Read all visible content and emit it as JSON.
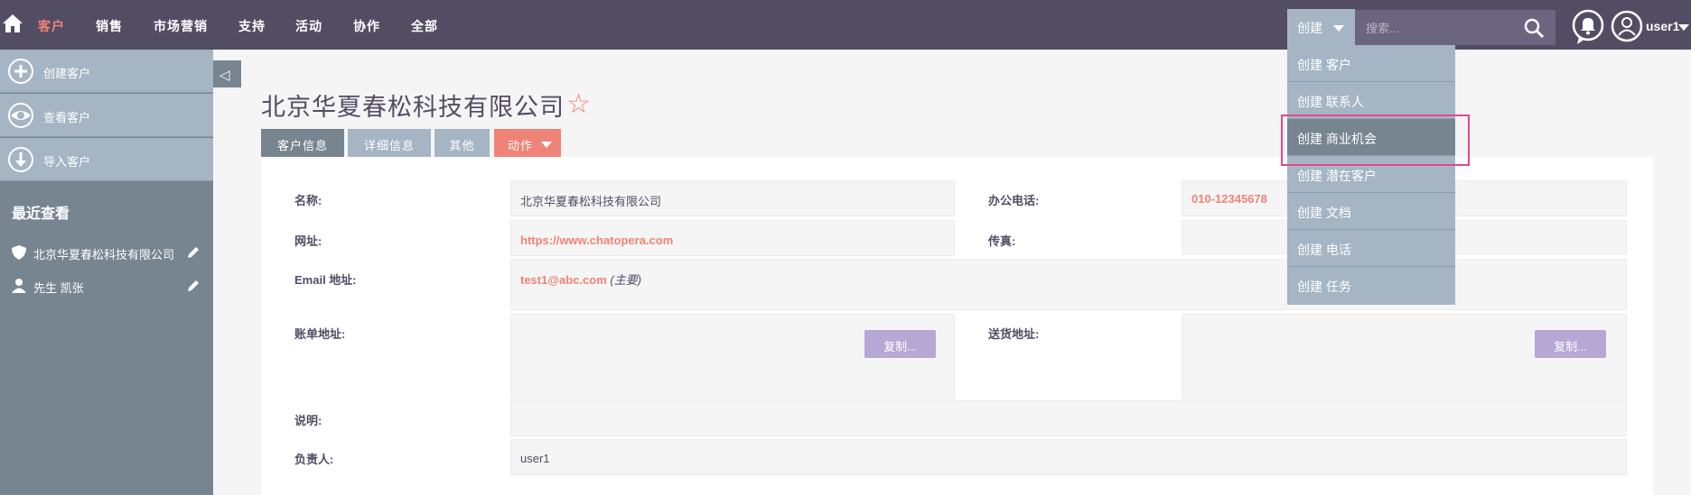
{
  "topnav": {
    "items": [
      "客户",
      "销售",
      "市场营销",
      "支持",
      "活动",
      "协作",
      "全部"
    ],
    "create_label": "创建",
    "search_placeholder": "搜索...",
    "user_name": "user1"
  },
  "create_menu": {
    "items": [
      "创建 客户",
      "创建 联系人",
      "创建 商业机会",
      "创建 潜在客户",
      "创建 文档",
      "创建 电话",
      "创建 任务"
    ],
    "highlighted_index": 2
  },
  "sidebar": {
    "actions": [
      "创建客户",
      "查看客户",
      "导入客户"
    ],
    "recent_title": "最近查看",
    "recent_items": [
      "北京华夏春松科技有限公司",
      "先生 凯张"
    ]
  },
  "record": {
    "title": "北京华夏春松科技有限公司",
    "tabs": [
      "客户信息",
      "详细信息",
      "其他",
      "动作"
    ],
    "fields": {
      "name_label": "名称:",
      "name_value": "北京华夏春松科技有限公司",
      "phone_label": "办公电话:",
      "phone_value": "010-12345678",
      "website_label": "网址:",
      "website_value": "https://www.chatopera.com",
      "fax_label": "传真:",
      "email_label": "Email 地址:",
      "email_value": "test1@abc.com",
      "email_note": "(主要)",
      "billing_label": "账单地址:",
      "shipping_label": "送货地址:",
      "copy_label": "复制...",
      "desc_label": "说明:",
      "owner_label": "负责人:",
      "owner_value": "user1"
    }
  },
  "colors": {
    "topbar": "#534d64",
    "accent": "#f08377",
    "sidebar": "#778591",
    "light_blue": "#a5b5c4",
    "copy_button": "#b6a7d4",
    "highlight": "#e5478f"
  }
}
